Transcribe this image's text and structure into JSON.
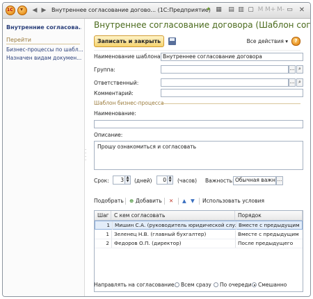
{
  "titlebar": {
    "title": "Внутреннее согласование догово... (1С:Предприятие)",
    "icons": [
      "logo-icon",
      "menu-icon",
      "back-icon",
      "forward-icon",
      "favorite-icon",
      "history-icon",
      "calendar-icon",
      "calculator-icon",
      "clipboard-icon",
      "memory-icon",
      "minimize-icon",
      "restore-icon",
      "close-icon"
    ],
    "mem": [
      "M",
      "M+",
      "M-"
    ],
    "close": "✕"
  },
  "sidebar": {
    "title": "Внутренние согласова...",
    "goto_label": "Перейти",
    "links": [
      "Бизнес-процессы по шабл...",
      "Назначен видам докумен..."
    ]
  },
  "header": {
    "title": "Внутреннее согласование договора (Шаблон сог...",
    "save_close": "Записать и закрыть",
    "all_actions": "Все действия ▾",
    "help": "?"
  },
  "form": {
    "name_label": "Наименование шаблона:",
    "name_value": "Внутреннее согласование договора",
    "group_label": "Группа:",
    "group_value": "",
    "responsible_label": "Ответственный:",
    "responsible_value": "",
    "comment_label": "Комментарий:",
    "comment_value": "",
    "section_title": "Шаблон бизнес-процесса",
    "bp_name_label": "Наименование:",
    "bp_name_value": "",
    "description_label": "Описание:",
    "description_value": "Прошу ознакомиться и согласовать",
    "term_label": "Срок:",
    "days_value": "3",
    "days_label": "(дней)",
    "hours_value": "0",
    "hours_label": "(часов)",
    "importance_label": "Важность:",
    "importance_value": "Обычная важно",
    "pick_glyph": "..."
  },
  "table_toolbar": {
    "pick": "Подобрать",
    "add": "Добавить",
    "use_conditions": "Использовать условия"
  },
  "table": {
    "columns": [
      "Шаг",
      "С кем согласовать",
      "Порядок"
    ],
    "rows": [
      {
        "step": "1",
        "who": "Мишин С.А. (руководитель юридической служ",
        "order": "Вместе с предыдущим",
        "selected": true
      },
      {
        "step": "1",
        "who": "Зеленец Н.В. (главный бухгалтер)",
        "order": "Вместе с предыдущим",
        "selected": false
      },
      {
        "step": "2",
        "who": "Федоров О.П. (директор)",
        "order": "После предыдущего",
        "selected": false
      }
    ]
  },
  "routing": {
    "label": "Направлять на согласование:",
    "options": [
      "Всем сразу",
      "По очереди",
      "Смешанно"
    ],
    "selected": "Смешанно"
  },
  "colors": {
    "accent_title": "#4a6a1c",
    "link": "#2a3f7a",
    "section": "#9a7a3a",
    "selected_row": "#e3edf9"
  }
}
